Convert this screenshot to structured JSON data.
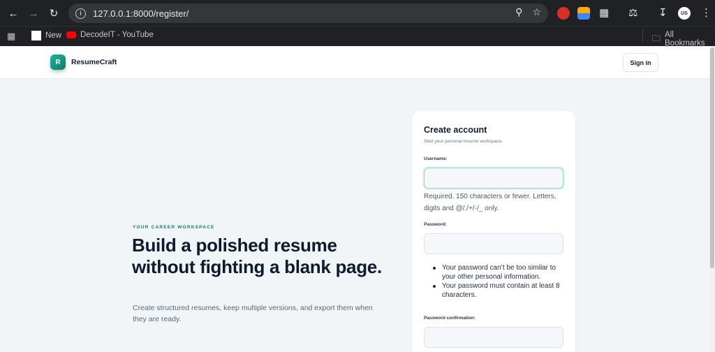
{
  "browser": {
    "url": "127.0.0.1:8000/register/",
    "bookmarks": [
      {
        "label": "New"
      },
      {
        "label": "DecodeIT - YouTube"
      }
    ],
    "all_bookmarks": "All Bookmarks",
    "profile_initials": "US"
  },
  "header": {
    "logo_letter": "R",
    "brand": "ResumeCraft",
    "signin_label": "Sign in"
  },
  "hero": {
    "eyebrow": "YOUR CAREER WORKSPACE",
    "title": "Build a polished resume without fighting a blank page.",
    "subtitle": "Create structured resumes, keep multiple versions, and export them when they are ready."
  },
  "form": {
    "title": "Create account",
    "subtitle": "Start your personal resume workspace.",
    "username_label": "Username:",
    "username_value": "",
    "username_help": "Required. 150 characters or fewer. Letters, digits and @/./+/-/_ only.",
    "password_label": "Password:",
    "password_value": "",
    "password_rules": [
      "Your password can’t be too similar to your other personal information.",
      "Your password must contain at least 8 characters."
    ],
    "password_confirm_label": "Password confirmation:",
    "password_confirm_value": ""
  }
}
